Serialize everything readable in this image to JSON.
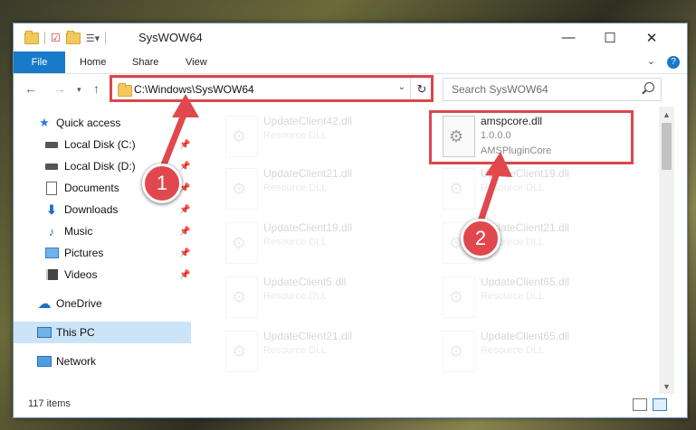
{
  "window": {
    "title": "SysWOW64"
  },
  "ribbon": {
    "tabs": [
      "File",
      "Home",
      "Share",
      "View"
    ]
  },
  "address": {
    "path": "C:\\Windows\\SysWOW64"
  },
  "search": {
    "placeholder": "Search SysWOW64"
  },
  "sidebar": {
    "items": [
      {
        "label": "Quick access",
        "icon": "star-icon",
        "pinned": false
      },
      {
        "label": "Local Disk (C:)",
        "icon": "drive-icon",
        "pinned": true
      },
      {
        "label": "Local Disk (D:)",
        "icon": "drive-icon",
        "pinned": true
      },
      {
        "label": "Documents",
        "icon": "documents-icon",
        "pinned": true
      },
      {
        "label": "Downloads",
        "icon": "downloads-icon",
        "pinned": true
      },
      {
        "label": "Music",
        "icon": "music-icon",
        "pinned": true
      },
      {
        "label": "Pictures",
        "icon": "pictures-icon",
        "pinned": true
      },
      {
        "label": "Videos",
        "icon": "videos-icon",
        "pinned": true
      },
      {
        "label": "OneDrive",
        "icon": "cloud-icon",
        "pinned": false
      },
      {
        "label": "This PC",
        "icon": "computer-icon",
        "pinned": false
      },
      {
        "label": "Network",
        "icon": "network-icon",
        "pinned": false
      }
    ]
  },
  "files": {
    "left": [
      {
        "name": "UpdateClient42.dll",
        "desc": "Resource DLL"
      },
      {
        "name": "UpdateClient21.dll",
        "desc": "Resource DLL"
      },
      {
        "name": "UpdateClient19.dll",
        "desc": "Resource DLL"
      },
      {
        "name": "UpdateClient5.dll",
        "desc": "Resource DLL"
      },
      {
        "name": "UpdateClient21.dll",
        "desc": "Resource DLL"
      }
    ],
    "right": [
      {
        "name": "amspcore.dll",
        "desc": "1.0.0.0",
        "desc2": "AMSPluginCore"
      },
      {
        "name": "UpdateClient19.dll",
        "desc": "Resource DLL"
      },
      {
        "name": "UpdateClient21.dll",
        "desc": "Resource DLL"
      },
      {
        "name": "UpdateClient65.dll",
        "desc": "Resource DLL"
      },
      {
        "name": "UpdateClient65.dll",
        "desc": "Resource DLL"
      }
    ]
  },
  "status": {
    "items": "117 items"
  },
  "annotations": {
    "step1": "1",
    "step2": "2"
  },
  "colors": {
    "accent": "#1979ca",
    "highlight": "#d9474d",
    "selected": "#cce4f7"
  }
}
